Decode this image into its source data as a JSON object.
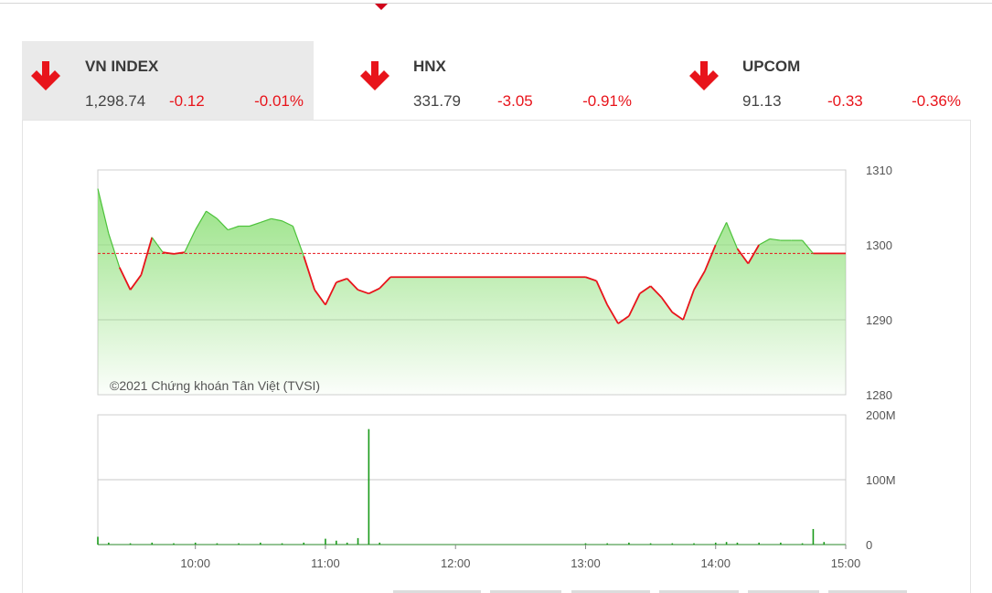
{
  "indices": [
    {
      "name": "VN INDEX",
      "value": "1,298.74",
      "change": "-0.12",
      "percent": "-0.01%",
      "icon": "arrow-down-icon",
      "active": true
    },
    {
      "name": "HNX",
      "value": "331.79",
      "change": "-3.05",
      "percent": "-0.91%",
      "icon": "arrow-down-icon",
      "active": false
    },
    {
      "name": "UPCOM",
      "value": "91.13",
      "change": "-0.33",
      "percent": "-0.36%",
      "icon": "arrow-down-icon",
      "active": false
    }
  ],
  "colors": {
    "down": "#e8141b",
    "area_fill": "#8fe07a",
    "volume": "#1a9a1a",
    "reference": "#e8141b"
  },
  "chart_data": [
    {
      "type": "line",
      "watermark": "©2021 Chứng khoán Tân Việt (TVSI)",
      "reference": 1298.86,
      "ylim": [
        1280,
        1310
      ],
      "y_ticks": [
        "1310",
        "1300",
        "1290",
        "1280"
      ],
      "x": [
        "09:15",
        "09:20",
        "09:25",
        "09:30",
        "09:35",
        "09:40",
        "09:45",
        "09:50",
        "09:55",
        "10:00",
        "10:05",
        "10:10",
        "10:15",
        "10:20",
        "10:25",
        "10:30",
        "10:35",
        "10:40",
        "10:45",
        "10:50",
        "10:55",
        "11:00",
        "11:05",
        "11:10",
        "11:15",
        "11:20",
        "11:25",
        "11:30",
        "13:00",
        "13:05",
        "13:10",
        "13:15",
        "13:20",
        "13:25",
        "13:30",
        "13:35",
        "13:40",
        "13:45",
        "13:50",
        "13:55",
        "14:00",
        "14:05",
        "14:10",
        "14:15",
        "14:20",
        "14:25",
        "14:30",
        "14:35",
        "14:40",
        "14:45",
        "15:00"
      ],
      "values": [
        1307.5,
        1301.5,
        1297,
        1294,
        1296,
        1301,
        1299,
        1298.8,
        1299,
        1302,
        1304.5,
        1303.5,
        1302,
        1302.5,
        1302.5,
        1303,
        1303.5,
        1303.2,
        1302.5,
        1298.5,
        1294,
        1292,
        1295,
        1295.5,
        1294,
        1293.5,
        1294.2,
        1295.7,
        1295.7,
        1295.2,
        1292,
        1289.5,
        1290.5,
        1293.5,
        1294.5,
        1293,
        1291,
        1290,
        1294,
        1296.5,
        1300,
        1303,
        1299.5,
        1297.5,
        1300,
        1300.8,
        1300.6,
        1300.6,
        1300.6,
        1298.86,
        1298.86
      ],
      "x_ticks": [
        "10:00",
        "11:00",
        "12:00",
        "13:00",
        "14:00",
        "15:00"
      ]
    },
    {
      "type": "bar",
      "ylim": [
        0,
        200
      ],
      "y_ticks": [
        "200M",
        "100M",
        "0"
      ],
      "x": [
        "09:15",
        "09:20",
        "09:30",
        "09:40",
        "09:50",
        "10:00",
        "10:10",
        "10:20",
        "10:30",
        "10:40",
        "10:50",
        "11:00",
        "11:05",
        "11:10",
        "11:15",
        "11:20",
        "11:25",
        "13:00",
        "13:10",
        "13:20",
        "13:30",
        "13:40",
        "13:50",
        "14:00",
        "14:05",
        "14:10",
        "14:20",
        "14:30",
        "14:40",
        "14:45",
        "14:50"
      ],
      "values": [
        12,
        3,
        2,
        3,
        2,
        3,
        2,
        2,
        3,
        2,
        3,
        9,
        6,
        3,
        10,
        178,
        3,
        2,
        2,
        3,
        2,
        2,
        2,
        3,
        4,
        3,
        3,
        3,
        2,
        24,
        4
      ],
      "x_ticks": [
        "10:00",
        "11:00",
        "12:00",
        "13:00",
        "14:00",
        "15:00"
      ]
    }
  ]
}
